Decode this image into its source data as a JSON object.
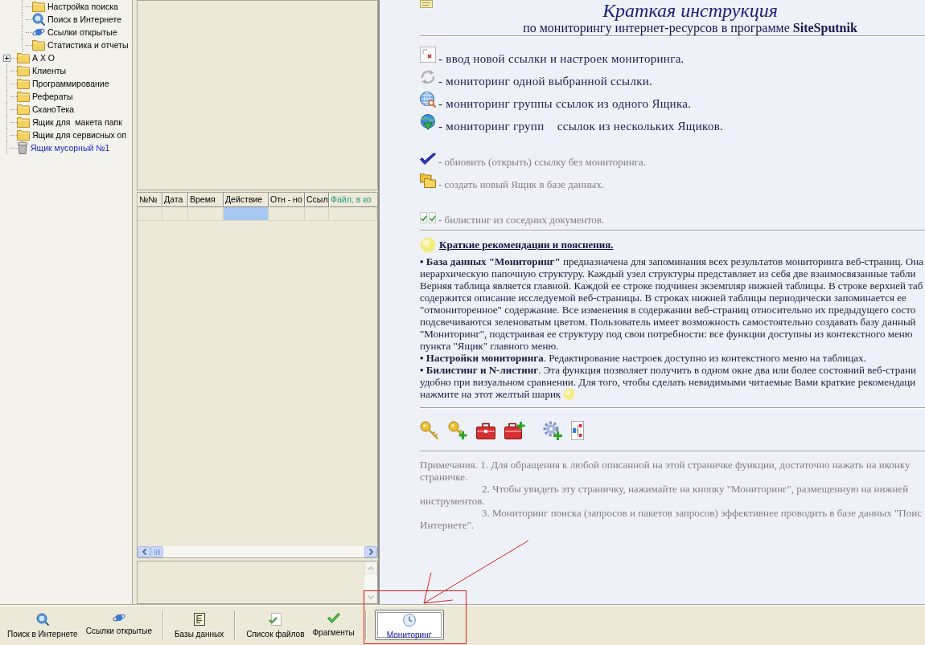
{
  "tree": {
    "items": [
      {
        "children": [
          {
            "label": "Настройка поиска",
            "kind": "folder"
          },
          {
            "label": "Поиск в Интернете",
            "kind": "search"
          },
          {
            "label": "Ссылки открытые",
            "kind": "links"
          },
          {
            "label": "Статистика и отчеты",
            "kind": "folder"
          }
        ]
      },
      {
        "label": "А Х О",
        "kind": "folder",
        "expanded": false
      },
      {
        "label": "Клиенты",
        "kind": "folder"
      },
      {
        "label": "Программирование",
        "kind": "folder"
      },
      {
        "label": "Рефераты",
        "kind": "folder"
      },
      {
        "label": "СканоТека",
        "kind": "folder"
      },
      {
        "label": "Ящик для  макета папк",
        "kind": "folder"
      },
      {
        "label": "Ящик для сервисных оп",
        "kind": "folder"
      },
      {
        "label": "Ящик мусорный №1",
        "kind": "trash"
      }
    ]
  },
  "table": {
    "columns": [
      {
        "label": "№№",
        "highlighted": false
      },
      {
        "label": "Дата",
        "highlighted": false
      },
      {
        "label": "Время",
        "highlighted": false
      },
      {
        "label": "Действие",
        "highlighted": false
      },
      {
        "label": "Отн - но",
        "highlighted": false
      },
      {
        "label": "Ссыл",
        "highlighted": false
      },
      {
        "label": "Файл, в ко",
        "highlighted": true
      }
    ],
    "rows": [
      {
        "cells": [
          {
            "selected": false
          },
          {
            "selected": false
          },
          {
            "selected": false
          },
          {
            "selected": true
          },
          {
            "selected": false
          },
          {
            "selected": false
          },
          {
            "selected": false
          }
        ]
      }
    ]
  },
  "instruction": {
    "title": "Краткая инструкция",
    "subtitle": "по мониторингу интернет-ресурсов в программе **SiteSputnik**",
    "groups": [
      {
        "items": [
          {
            "text": "- ввод новой ссылки и настроек мониторинга.",
            "kind": "major"
          },
          {
            "text": "- мониторинг одной выбранной ссылки.",
            "kind": "major"
          },
          {
            "text": "- мониторинг группы ссылок из одного Ящика.",
            "kind": "major"
          },
          {
            "text": "- мониторинг групп    ссылок из нескольких Ящиков.",
            "kind": "major"
          }
        ]
      },
      {
        "items": [
          {
            "text": "- обновить (открыть) ссылку без мониторинга.",
            "kind": "minor"
          },
          {
            "text": "- создать новый Ящик в базе данных.",
            "kind": "minor"
          }
        ]
      },
      {
        "items": [
          {
            "text": "- билистинг из соседних документов.",
            "kind": "minor"
          }
        ]
      }
    ]
  },
  "recommendations": {
    "title": "Краткие рекомендации и пояснения.",
    "paragraphs": [
      {
        "lines": [
          "**• База данных \"Мониторинг\"** предназначена для запоминания всех результатов мониторинга веб-страниц. Она",
          "иерархическую папочную структуру. Каждый узел структуры представляет из себя две взаимосвязанные табли",
          "Верняя таблица является главной. Каждой ее строке подчинен экземпляр нижней таблицы. В строке верхней таб",
          "содержится описание исследуемой веб-страницы. В строках нижней таблицы периодически запоминается ее",
          "\"отмониторенное\" содержание. Все изменения в содержании веб-страниц относительно их предыдущего состо",
          "подсвечиваются зеленоватым цветом. Пользователь имеет возможность самостоятельно создавать базу данный",
          "\"Мониторинг\", подстраивая ее структуру под свои потребности: все функции доступны из контекстного меню",
          "пункта \"Ящик\" главного меню."
        ]
      },
      {
        "lines": [
          "**• Настройки мониторинга**. Редактирование настроек доступно из контекстного меню на таблицах."
        ]
      },
      {
        "lines": [
          "**• Билистинг и N-листинг**. Эта функция позволяет получить в одном окне два или более состояний веб-страни",
          "удобно при визуальном сравнении. Для того, чтобы сделать невидимыми читаемые Вами краткие рекомендаци"
        ],
        "closing_line": "нажмите на этот желтый шарик"
      }
    ]
  },
  "notes": [
    {
      "lines": [
        "Примечания. 1. Для обращения к любой описанной на этой страничке функции, достаточно нажать на иконку",
        "страничке."
      ]
    },
    {
      "lines": [
        "2. Чтобы увидеть эту страничку, нажимайте на кнопку \"Мониторинг\", размещенную на нижней",
        "инструментов."
      ]
    },
    {
      "lines": [
        "3. Мониторинг поиска (запросов и пакетов запросов) эффективнее проводить в базе данных \"Поис",
        "Интернете\"."
      ]
    }
  ],
  "toolbar": {
    "groups": [
      {
        "buttons": [
          {
            "label": "Поиск в Интернете",
            "selected": false
          },
          {
            "label": "Ссылки открытые",
            "selected": false
          }
        ]
      },
      {
        "buttons": [
          {
            "label": "Базы данных",
            "selected": false
          }
        ]
      },
      {
        "buttons": [
          {
            "label": "Список файлов",
            "selected": false
          },
          {
            "label": "Фрагменты",
            "selected": false
          }
        ]
      },
      {
        "buttons": [
          {
            "label": "Мониторинг",
            "selected": true
          }
        ]
      }
    ]
  }
}
